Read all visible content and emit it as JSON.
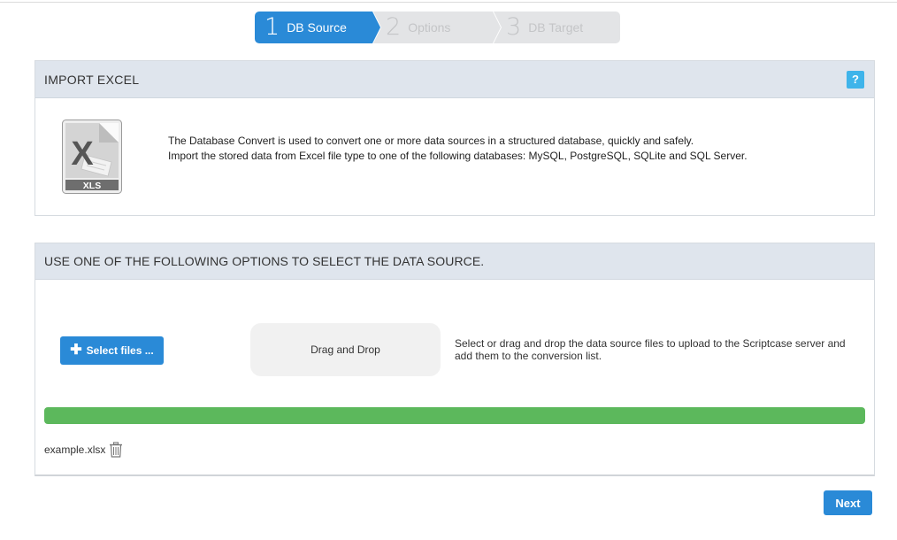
{
  "wizard": {
    "steps": [
      {
        "number": "1",
        "label": "DB Source",
        "state": "active"
      },
      {
        "number": "2",
        "label": "Options",
        "state": "inactive"
      },
      {
        "number": "3",
        "label": "DB Target",
        "state": "inactive"
      }
    ]
  },
  "import_panel": {
    "title": "IMPORT EXCEL",
    "help_label": "?",
    "icon": "xls-file-icon",
    "icon_badge": "XLS",
    "description_line1": "The Database Convert is used to convert one or more data sources in a structured database, quickly and safely.",
    "description_line2": "Import the stored data from Excel file type to one of the following databases: MySQL, PostgreSQL, SQLite and SQL Server."
  },
  "source_panel": {
    "title": "USE ONE OF THE FOLLOWING OPTIONS TO SELECT THE DATA SOURCE.",
    "select_button": {
      "icon": "plus-icon",
      "label": "Select files ..."
    },
    "dropzone_label": "Drag and Drop",
    "hint": "Select or drag and drop the data source files to upload to the Scriptcase server and add them to the conversion list.",
    "progress_fraction": 1.0,
    "files": [
      {
        "name": "example.xlsx",
        "action_icon": "trash-icon"
      }
    ]
  },
  "footer": {
    "next_label": "Next"
  },
  "colors": {
    "accent": "#2a8ad7",
    "panel_header": "#dfe5ed",
    "progress": "#5cb85c",
    "help": "#3fb4ea",
    "inactive_step": "#e3e4e6"
  }
}
